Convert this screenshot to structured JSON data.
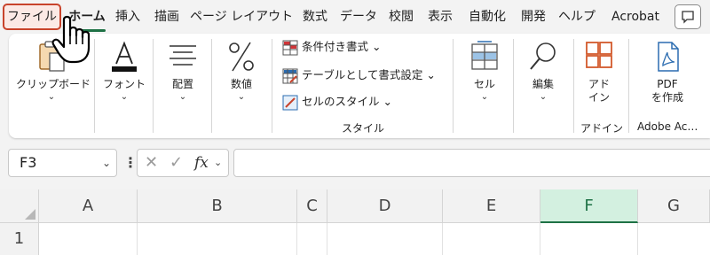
{
  "tabs": [
    {
      "label": "ファイル"
    },
    {
      "label": "ホーム"
    },
    {
      "label": "挿入"
    },
    {
      "label": "描画"
    },
    {
      "label": "ページ レイアウト"
    },
    {
      "label": "数式"
    },
    {
      "label": "データ"
    },
    {
      "label": "校閲"
    },
    {
      "label": "表示"
    },
    {
      "label": "自動化"
    },
    {
      "label": "開発"
    },
    {
      "label": "ヘルプ"
    },
    {
      "label": "Acrobat"
    }
  ],
  "ribbon": {
    "clipboard": "クリップボード",
    "font": "フォント",
    "align": "配置",
    "number": "数値",
    "cond_format": "条件付き書式",
    "table_format": "テーブルとして書式設定",
    "cell_style": "セルのスタイル",
    "style_group": "スタイル",
    "cell": "セル",
    "edit": "編集",
    "addin_line1": "アド",
    "addin_line2": "イン",
    "addin_group": "アドイン",
    "pdf_line1": "PDF",
    "pdf_line2": "を作成",
    "adobe_group": "Adobe Ac…"
  },
  "formula_bar": {
    "name_box": "F3",
    "fx": "fx",
    "formula": ""
  },
  "grid": {
    "columns": [
      "A",
      "B",
      "C",
      "D",
      "E",
      "F",
      "G"
    ],
    "selected_column": "F",
    "rows": [
      "1"
    ]
  },
  "colors": {
    "accent": "#1e7145",
    "file_highlight": "#c8432b"
  }
}
